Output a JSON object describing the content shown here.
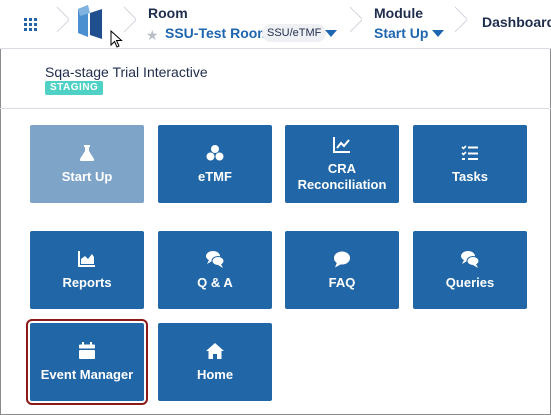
{
  "header": {
    "room_title": "Room",
    "room_value": "SSU-Test Room",
    "room_tag": "SSU/eTMF",
    "module_title": "Module",
    "module_value": "Start Up",
    "dashboard_label": "Dashboard"
  },
  "trial": {
    "name": "Sqa-stage Trial Interactive",
    "badge": "STAGING"
  },
  "tiles": [
    {
      "label": "Start Up",
      "icon": "flask-icon"
    },
    {
      "label": "eTMF",
      "icon": "cubes-icon"
    },
    {
      "label": "CRA Reconciliation",
      "icon": "line-chart-icon"
    },
    {
      "label": "Tasks",
      "icon": "tasks-icon"
    },
    {
      "label": "Reports",
      "icon": "area-chart-icon"
    },
    {
      "label": "Q & A",
      "icon": "comments-icon"
    },
    {
      "label": "FAQ",
      "icon": "comment-icon"
    },
    {
      "label": "Queries",
      "icon": "comments-icon"
    },
    {
      "label": "Event Manager",
      "icon": "calendar-icon"
    },
    {
      "label": "Home",
      "icon": "home-icon"
    }
  ],
  "colors": {
    "tile": "#2166a6",
    "tile_active": "#7ea4c8",
    "accent": "#1f66b0",
    "badge": "#4fd1c5",
    "selection_outline": "#8b1a1a"
  }
}
